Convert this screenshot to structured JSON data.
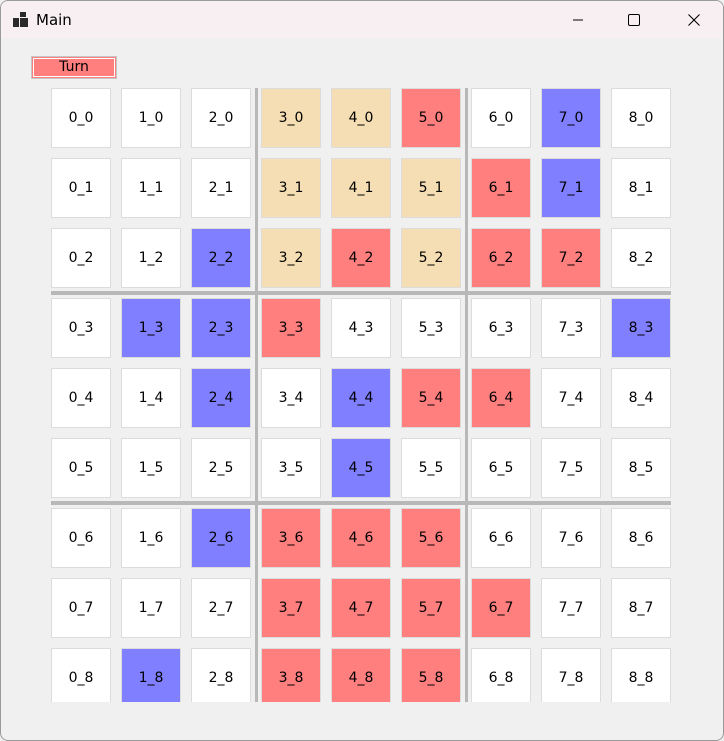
{
  "window": {
    "title": "Main",
    "controls": {
      "minimize": "minimize-icon",
      "maximize": "maximize-icon",
      "close": "close-icon"
    }
  },
  "turn_button": {
    "label": "Turn",
    "color": "#ff7f7f"
  },
  "colors": {
    "white": "#ffffff",
    "tan": "#f5deb3",
    "red": "#ff7f7f",
    "blue": "#7f7fff"
  },
  "board": {
    "rows": [
      [
        {
          "label": "0_0",
          "color": "white"
        },
        {
          "label": "1_0",
          "color": "white"
        },
        {
          "label": "2_0",
          "color": "white"
        },
        {
          "label": "3_0",
          "color": "tan"
        },
        {
          "label": "4_0",
          "color": "tan"
        },
        {
          "label": "5_0",
          "color": "red"
        },
        {
          "label": "6_0",
          "color": "white"
        },
        {
          "label": "7_0",
          "color": "blue"
        },
        {
          "label": "8_0",
          "color": "white"
        }
      ],
      [
        {
          "label": "0_1",
          "color": "white"
        },
        {
          "label": "1_1",
          "color": "white"
        },
        {
          "label": "2_1",
          "color": "white"
        },
        {
          "label": "3_1",
          "color": "tan"
        },
        {
          "label": "4_1",
          "color": "tan"
        },
        {
          "label": "5_1",
          "color": "tan"
        },
        {
          "label": "6_1",
          "color": "red"
        },
        {
          "label": "7_1",
          "color": "blue"
        },
        {
          "label": "8_1",
          "color": "white"
        }
      ],
      [
        {
          "label": "0_2",
          "color": "white"
        },
        {
          "label": "1_2",
          "color": "white"
        },
        {
          "label": "2_2",
          "color": "blue"
        },
        {
          "label": "3_2",
          "color": "tan"
        },
        {
          "label": "4_2",
          "color": "red"
        },
        {
          "label": "5_2",
          "color": "tan"
        },
        {
          "label": "6_2",
          "color": "red"
        },
        {
          "label": "7_2",
          "color": "red"
        },
        {
          "label": "8_2",
          "color": "white"
        }
      ],
      [
        {
          "label": "0_3",
          "color": "white"
        },
        {
          "label": "1_3",
          "color": "blue"
        },
        {
          "label": "2_3",
          "color": "blue"
        },
        {
          "label": "3_3",
          "color": "red"
        },
        {
          "label": "4_3",
          "color": "white"
        },
        {
          "label": "5_3",
          "color": "white"
        },
        {
          "label": "6_3",
          "color": "white"
        },
        {
          "label": "7_3",
          "color": "white"
        },
        {
          "label": "8_3",
          "color": "blue"
        }
      ],
      [
        {
          "label": "0_4",
          "color": "white"
        },
        {
          "label": "1_4",
          "color": "white"
        },
        {
          "label": "2_4",
          "color": "blue"
        },
        {
          "label": "3_4",
          "color": "white"
        },
        {
          "label": "4_4",
          "color": "blue"
        },
        {
          "label": "5_4",
          "color": "red"
        },
        {
          "label": "6_4",
          "color": "red"
        },
        {
          "label": "7_4",
          "color": "white"
        },
        {
          "label": "8_4",
          "color": "white"
        }
      ],
      [
        {
          "label": "0_5",
          "color": "white"
        },
        {
          "label": "1_5",
          "color": "white"
        },
        {
          "label": "2_5",
          "color": "white"
        },
        {
          "label": "3_5",
          "color": "white"
        },
        {
          "label": "4_5",
          "color": "blue"
        },
        {
          "label": "5_5",
          "color": "white"
        },
        {
          "label": "6_5",
          "color": "white"
        },
        {
          "label": "7_5",
          "color": "white"
        },
        {
          "label": "8_5",
          "color": "white"
        }
      ],
      [
        {
          "label": "0_6",
          "color": "white"
        },
        {
          "label": "1_6",
          "color": "white"
        },
        {
          "label": "2_6",
          "color": "blue"
        },
        {
          "label": "3_6",
          "color": "red"
        },
        {
          "label": "4_6",
          "color": "red"
        },
        {
          "label": "5_6",
          "color": "red"
        },
        {
          "label": "6_6",
          "color": "white"
        },
        {
          "label": "7_6",
          "color": "white"
        },
        {
          "label": "8_6",
          "color": "white"
        }
      ],
      [
        {
          "label": "0_7",
          "color": "white"
        },
        {
          "label": "1_7",
          "color": "white"
        },
        {
          "label": "2_7",
          "color": "white"
        },
        {
          "label": "3_7",
          "color": "red"
        },
        {
          "label": "4_7",
          "color": "red"
        },
        {
          "label": "5_7",
          "color": "red"
        },
        {
          "label": "6_7",
          "color": "red"
        },
        {
          "label": "7_7",
          "color": "white"
        },
        {
          "label": "8_7",
          "color": "white"
        }
      ],
      [
        {
          "label": "0_8",
          "color": "white"
        },
        {
          "label": "1_8",
          "color": "blue"
        },
        {
          "label": "2_8",
          "color": "white"
        },
        {
          "label": "3_8",
          "color": "red"
        },
        {
          "label": "4_8",
          "color": "red"
        },
        {
          "label": "5_8",
          "color": "red"
        },
        {
          "label": "6_8",
          "color": "white"
        },
        {
          "label": "7_8",
          "color": "white"
        },
        {
          "label": "8_8",
          "color": "white"
        }
      ]
    ]
  }
}
